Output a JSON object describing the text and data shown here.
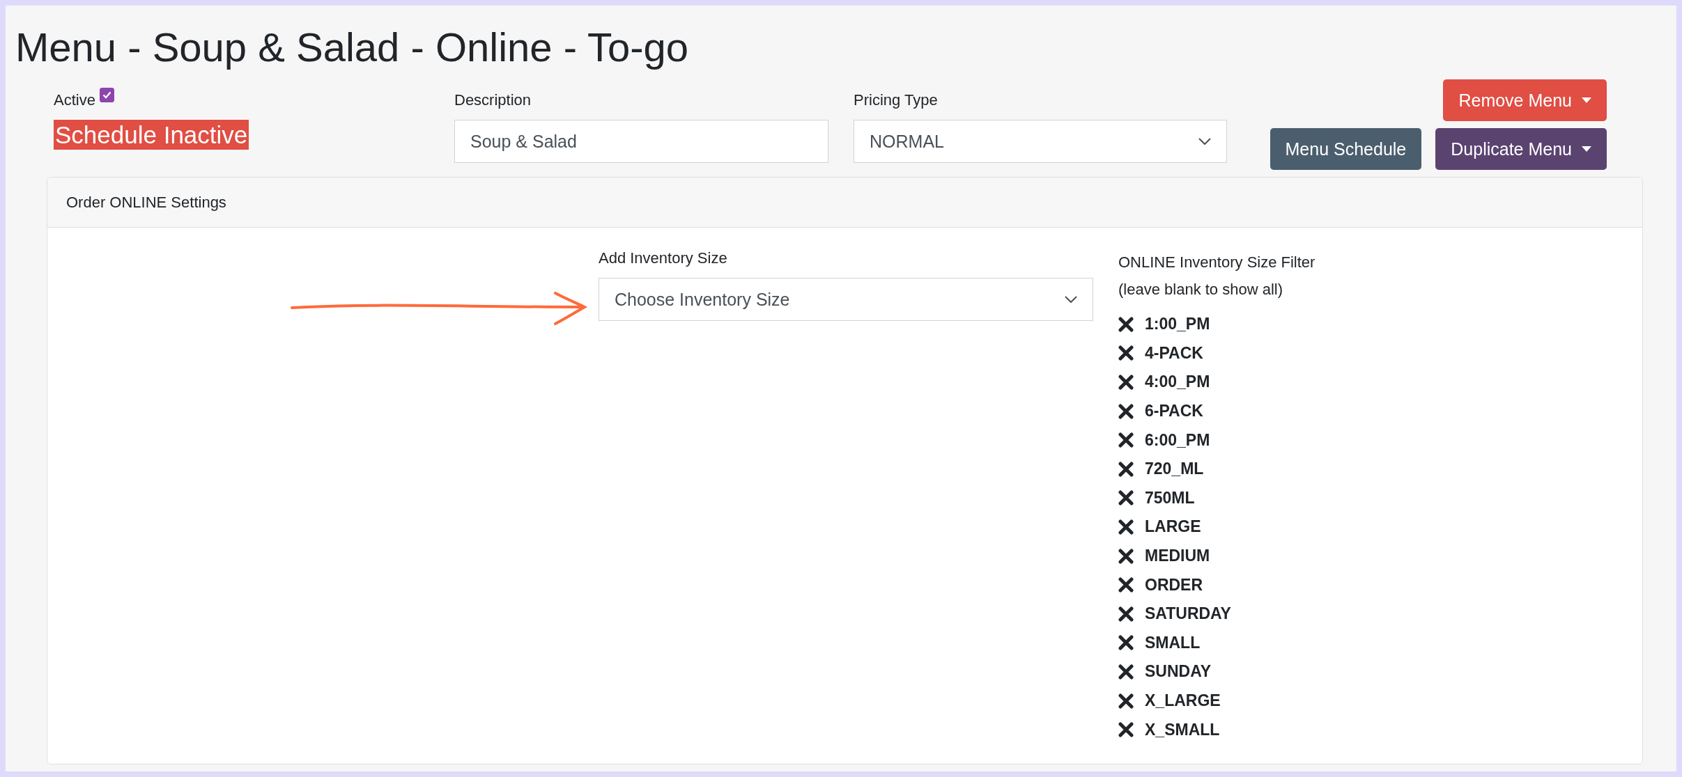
{
  "title": "Menu - Soup & Salad - Online - To-go",
  "active": {
    "label": "Active",
    "checked": true
  },
  "schedule_status": "Schedule Inactive",
  "description": {
    "label": "Description",
    "value": "Soup & Salad"
  },
  "pricing_type": {
    "label": "Pricing Type",
    "value": "NORMAL"
  },
  "buttons": [
    {
      "label": "Remove Menu",
      "kind": "danger",
      "caret": true
    },
    {
      "label": "Menu Schedule",
      "kind": "slate",
      "caret": false
    },
    {
      "label": "Duplicate Menu",
      "kind": "purple",
      "caret": true
    }
  ],
  "card": {
    "header": "Order ONLINE Settings",
    "add_size": {
      "label": "Add Inventory Size",
      "placeholder": "Choose Inventory Size"
    },
    "filter": {
      "label": "ONLINE Inventory Size Filter",
      "hint": "(leave blank to show all)",
      "items": [
        "1:00_PM",
        "4-PACK",
        "4:00_PM",
        "6-PACK",
        "6:00_PM",
        "720_ML",
        "750ML",
        "LARGE",
        "MEDIUM",
        "ORDER",
        "SATURDAY",
        "SMALL",
        "SUNDAY",
        "X_LARGE",
        "X_SMALL"
      ]
    }
  }
}
